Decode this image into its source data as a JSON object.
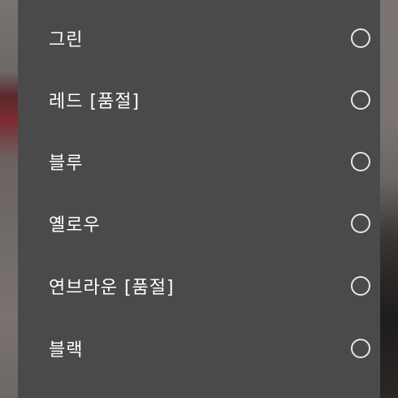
{
  "options": [
    {
      "label": "그린",
      "selected": false
    },
    {
      "label": "레드 [품절]",
      "selected": false
    },
    {
      "label": "블루",
      "selected": false
    },
    {
      "label": "옐로우",
      "selected": false
    },
    {
      "label": "연브라운 [품절]",
      "selected": false
    },
    {
      "label": "블랙",
      "selected": false
    }
  ],
  "colors": {
    "sheet_background": "#4a4a4a",
    "label_text": "#ffffff",
    "radio_ring": "#e6e6e6"
  },
  "icons": {
    "radio": "radio-unchecked-icon"
  }
}
